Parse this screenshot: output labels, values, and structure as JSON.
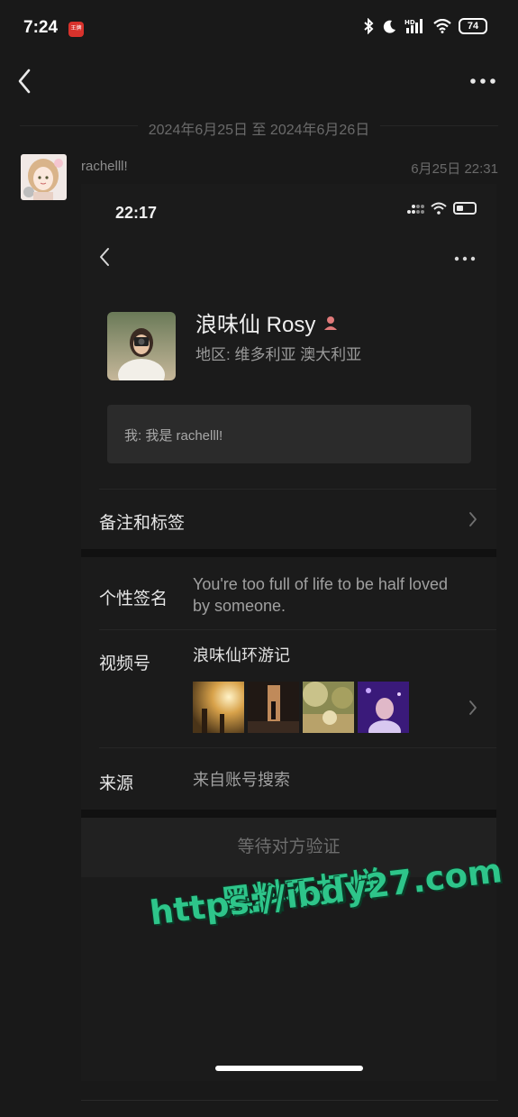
{
  "status_bar": {
    "time": "7:24",
    "app_badge": "王牌",
    "battery": "74",
    "icons": [
      "bluetooth-icon",
      "moon-icon",
      "hd-signal-icon",
      "wifi-icon",
      "battery-icon"
    ]
  },
  "header": {
    "back_icon": "chevron-left-icon",
    "more_icon": "more-dots-icon"
  },
  "chat": {
    "date_range": "2024年6月25日 至 2024年6月26日",
    "message": {
      "sender": "rachelll!",
      "time": "6月25日 22:31"
    }
  },
  "screenshot": {
    "time": "22:17",
    "profile": {
      "name": "浪味仙 Rosy",
      "region": "地区: 维多利亚 澳大利亚"
    },
    "greeting": "我: 我是 rachelll!",
    "remarks_label": "备注和标签",
    "signature_label": "个性签名",
    "signature_value": "You're too full of life to be half loved by someone.",
    "channels_label": "视频号",
    "channels_value": "浪味仙环游记",
    "source_label": "来源",
    "source_value": "来自账号搜索",
    "verify_button": "等待对方验证"
  },
  "watermark": {
    "line1": "黑料不打烊",
    "line2": "https://ibdy27.com"
  },
  "colors": {
    "background": "#191919",
    "card": "#1b1b1b",
    "watermark": "#2ec58a"
  }
}
